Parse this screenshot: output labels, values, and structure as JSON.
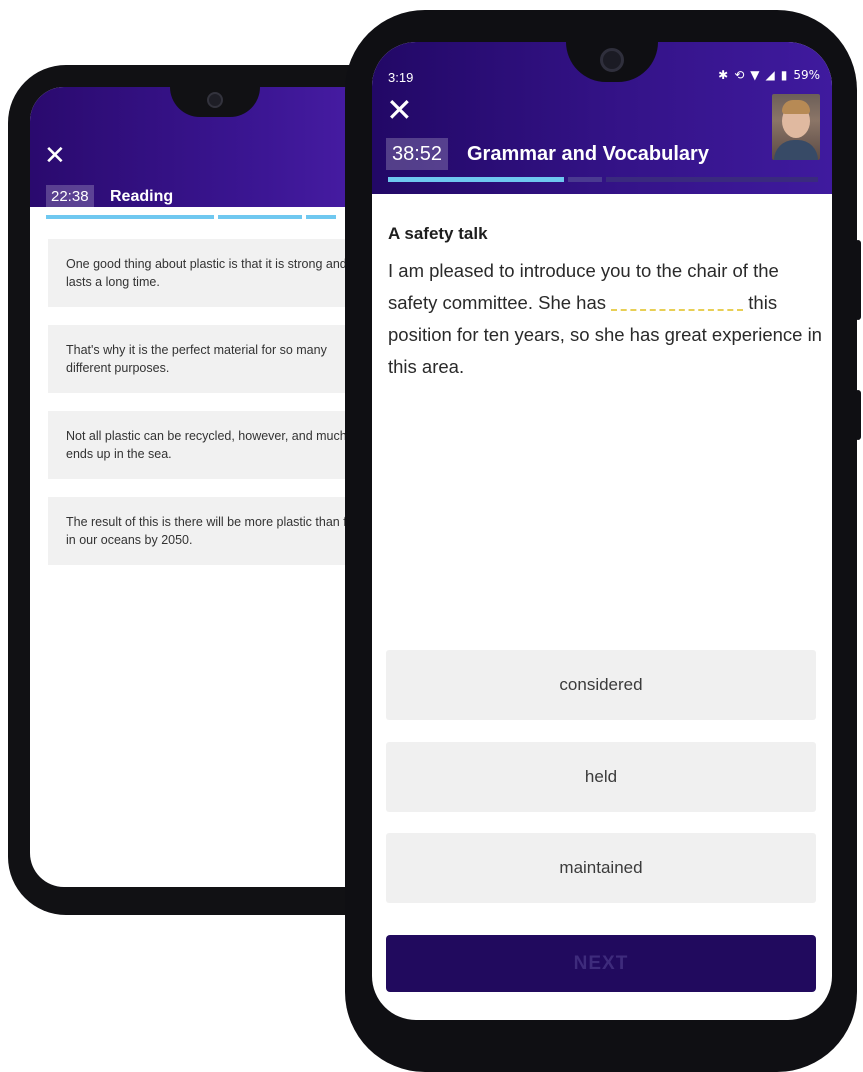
{
  "back_screen": {
    "close_icon": "close-icon",
    "timer": "22:38",
    "title": "Reading",
    "progress_segments": 4,
    "cards": [
      "One good thing about plastic is that it is strong and lasts a long time.",
      "That's why it is the perfect material for so many different purposes.",
      "Not all plastic can be recycled, however, and much of it ends up in the sea.",
      "The result of this is there will be more plastic than fish in our oceans by 2050."
    ]
  },
  "front_screen": {
    "status": {
      "time": "3:19",
      "battery": "59%"
    },
    "close_icon": "close-icon",
    "timer": "38:52",
    "title": "Grammar and Vocabulary",
    "progress": {
      "completed_segments": 1,
      "total_segments": 3
    },
    "question": {
      "title": "A safety talk",
      "text_before": "I am pleased to introduce you to the chair of the safety committee. She has",
      "text_after": "this position for ten years, so she has great experience in this area."
    },
    "options": [
      "considered",
      "held",
      "maintained"
    ],
    "next_label": "NEXT"
  },
  "colors": {
    "header_purple": "#341388",
    "progress_blue": "#6fc8f0",
    "next_button": "#210a5e",
    "blank_underline": "#e8cf55"
  }
}
